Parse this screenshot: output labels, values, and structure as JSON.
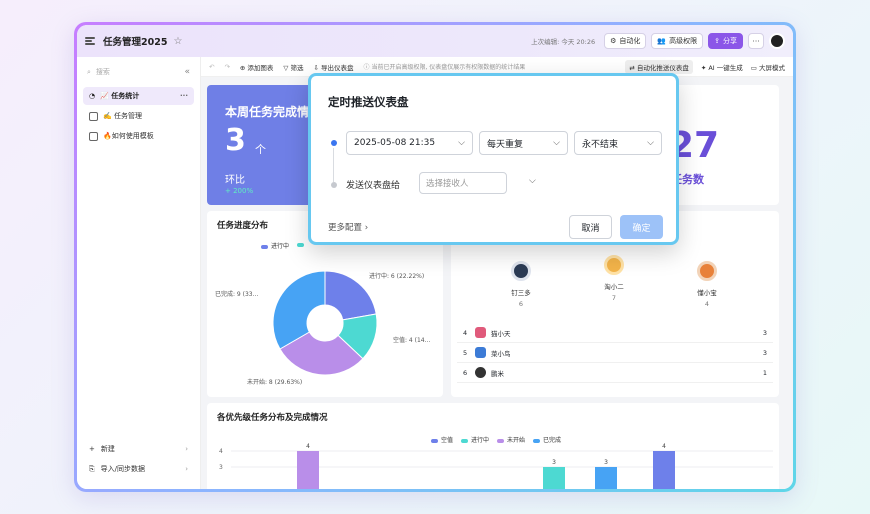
{
  "app": {
    "title": "任务管理2025",
    "last_edit": "上次编辑: 今天 20:26",
    "automation_btn": "自动化",
    "advanced_perm_btn": "高级权限",
    "share_btn": "分享",
    "more_btn": "···"
  },
  "sidebar": {
    "search_placeholder": "搜索",
    "items": [
      {
        "label": "📈 任务统计",
        "active": true
      },
      {
        "label": "✍️ 任务管理",
        "active": false
      },
      {
        "label": "🔥如何使用模板",
        "active": false
      }
    ],
    "new_label": "新建",
    "import_label": "导入/同步数据"
  },
  "toolbar": {
    "add_chart": "添加图表",
    "filter": "筛选",
    "export": "导出仪表盘",
    "hint": "当前已开启高级权限, 仪表盘仅展示有权限数据的统计结果",
    "auto_push": "自动化推送仪表盘",
    "ai_generate": "AI 一键生成",
    "big_screen": "大屏模式"
  },
  "kpi_week": {
    "title": "本周任务完成情",
    "value": "3",
    "unit": "个",
    "compare_label": "环比",
    "compare_value": "+ 200%"
  },
  "kpi_total": {
    "value": "27",
    "label": "任务数"
  },
  "progress_chart": {
    "title": "任务进度分布"
  },
  "chart_data": [
    {
      "type": "pie",
      "title": "任务进度分布",
      "legend": [
        "进行中"
      ],
      "slices": [
        {
          "name": "进行中",
          "value": 6,
          "percent": "22.22%",
          "label": "进行中: 6 (22.22%)",
          "color": "#6e80ea"
        },
        {
          "name": "空值",
          "value": 4,
          "percent": "14...",
          "label": "空值: 4 (14...",
          "color": "#4dd9d2"
        },
        {
          "name": "未开始",
          "value": 8,
          "percent": "29.63%",
          "label": "未开始: 8 (29.63%)",
          "color": "#b98ee9"
        },
        {
          "name": "已完成",
          "value": 9,
          "percent": "33...",
          "label": "已完成: 9 (33...",
          "color": "#47a3f4"
        }
      ]
    },
    {
      "type": "bar",
      "title": "各优先级任务分布及完成情况",
      "legend": [
        "空值",
        "进行中",
        "未开始",
        "已完成"
      ],
      "colors": {
        "空值": "#6e80ea",
        "进行中": "#4dd9d2",
        "未开始": "#b98ee9",
        "已完成": "#47a3f4"
      },
      "yticks": [
        "4",
        "3"
      ],
      "bars": [
        {
          "series": "未开始",
          "value": 4
        },
        {
          "series": "进行中",
          "value": 3
        },
        {
          "series": "已完成",
          "value": 3
        },
        {
          "series": "空值",
          "value": 4
        }
      ]
    }
  ],
  "ranking": {
    "podium": [
      {
        "name": "钉三多",
        "count": "6"
      },
      {
        "name": "淘小二",
        "count": "7"
      },
      {
        "name": "懂小宝",
        "count": "4"
      }
    ],
    "rows": [
      {
        "rank": "4",
        "name": "猫小天",
        "count": "3"
      },
      {
        "rank": "5",
        "name": "菜小鸟",
        "count": "3"
      },
      {
        "rank": "6",
        "name": "鹏米",
        "count": "1"
      }
    ]
  },
  "priority_chart": {
    "title": "各优先级任务分布及完成情况"
  },
  "modal": {
    "title": "定时推送仪表盘",
    "datetime": "2025-05-08 21:35",
    "repeat": "每天重复",
    "end": "永不结束",
    "send_to_label": "发送仪表盘给",
    "receiver_placeholder": "选择接收人",
    "more_config": "更多配置",
    "cancel": "取消",
    "confirm": "确定"
  }
}
